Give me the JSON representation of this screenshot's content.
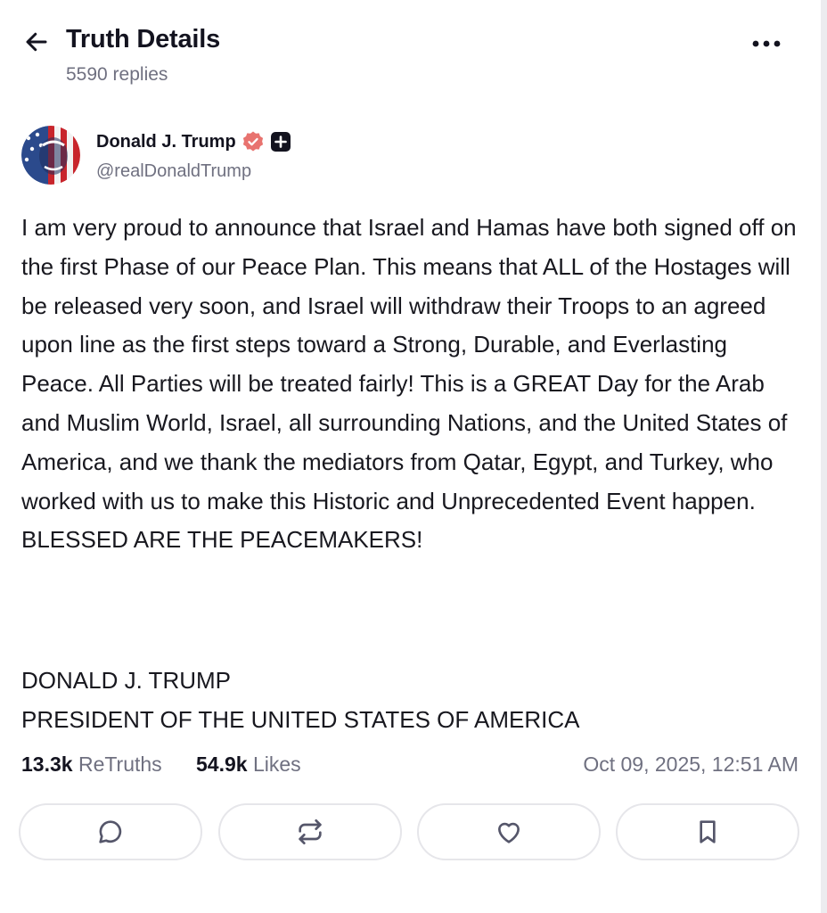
{
  "header": {
    "title": "Truth Details",
    "reply_count": "5590 replies",
    "back_icon": "arrow-left-icon",
    "more_icon": "ellipsis-horizontal-icon"
  },
  "author": {
    "display_name": "Donald J. Trump",
    "handle": "@realDonaldTrump",
    "verified_icon": "verified-badge-icon",
    "plus_icon": "truth-plus-icon",
    "verified_color": "#e8736f"
  },
  "post": {
    "paragraphs": [
      "I am very proud to announce that Israel and Hamas have both signed off on the first Phase of our Peace Plan. This means that ALL of the Hostages will be released very soon, and Israel will withdraw their Troops to an agreed upon line as the first steps toward a Strong, Durable, and Everlasting Peace. All Parties will be treated fairly! This is a GREAT Day for the Arab and Muslim World, Israel, all surrounding Nations, and the United States of America, and we thank the mediators from Qatar, Egypt, and Turkey, who worked with us to make this Historic and Unprecedented Event happen. BLESSED ARE THE PEACEMAKERS!"
    ],
    "signature_line_1": "DONALD J. TRUMP",
    "signature_line_2": "PRESIDENT OF THE UNITED STATES OF AMERICA"
  },
  "stats": {
    "retruths_count": "13.3k",
    "retruths_label": "ReTruths",
    "likes_count": "54.9k",
    "likes_label": "Likes",
    "timestamp": "Oct 09, 2025, 12:51 AM"
  },
  "actions": [
    {
      "icon": "reply-icon"
    },
    {
      "icon": "retruth-icon"
    },
    {
      "icon": "like-icon"
    },
    {
      "icon": "bookmark-icon"
    }
  ]
}
